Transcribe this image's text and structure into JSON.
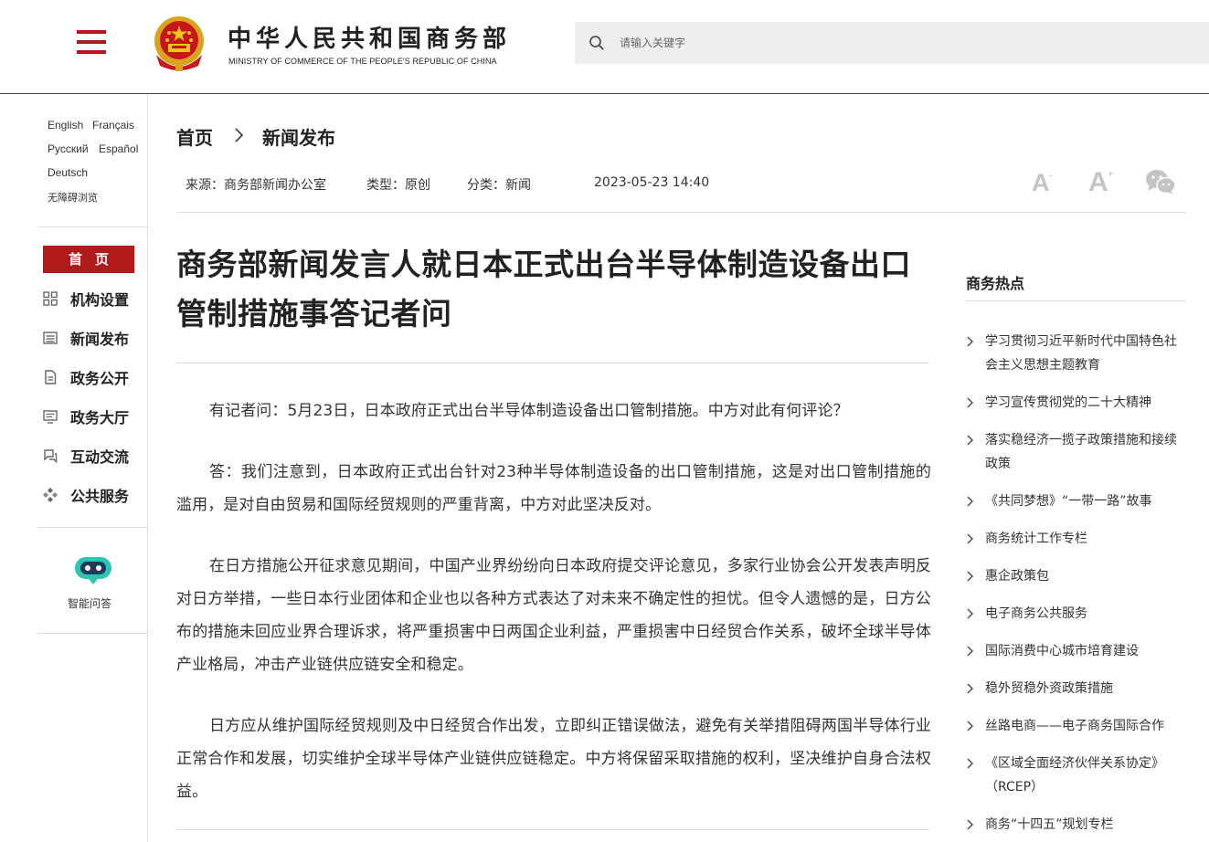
{
  "header": {
    "site_title_cn": "中华人民共和国商务部",
    "site_title_en": "MINISTRY OF COMMERCE OF THE PEOPLE'S REPUBLIC OF CHINA",
    "search_placeholder": "请输入关键字",
    "accent_color": "#b01a1a"
  },
  "languages": {
    "english": "English",
    "french": "Français",
    "russian": "Русский",
    "spanish": "Español",
    "german": "Deutsch",
    "accessible": "无障碍浏览"
  },
  "sidebar": {
    "home": "首页",
    "items": [
      {
        "label": "机构设置",
        "icon": "grid-icon"
      },
      {
        "label": "新闻发布",
        "icon": "news-icon"
      },
      {
        "label": "政务公开",
        "icon": "document-icon"
      },
      {
        "label": "政务大厅",
        "icon": "screen-icon"
      },
      {
        "label": "互动交流",
        "icon": "chat-icon"
      },
      {
        "label": "公共服务",
        "icon": "service-icon"
      }
    ],
    "assistant_label": "智能问答"
  },
  "breadcrumb": {
    "home": "首页",
    "current": "新闻发布"
  },
  "meta": {
    "source": "来源：商务部新闻办公室",
    "type": "类型：原创",
    "category": "分类：新闻",
    "datetime": "2023-05-23 14:40"
  },
  "article": {
    "title": "商务部新闻发言人就日本正式出台半导体制造设备出口管制措施事答记者问",
    "paragraphs": [
      "有记者问：5月23日，日本政府正式出台半导体制造设备出口管制措施。中方对此有何评论？",
      "答：我们注意到，日本政府正式出台针对23种半导体制造设备的出口管制措施，这是对出口管制措施的滥用，是对自由贸易和国际经贸规则的严重背离，中方对此坚决反对。",
      "在日方措施公开征求意见期间，中国产业界纷纷向日本政府提交评论意见，多家行业协会公开发表声明反对日方举措，一些日本行业团体和企业也以各种方式表达了对未来不确定性的担忧。但令人遗憾的是，日方公布的措施未回应业界合理诉求，将严重损害中日两国企业利益，严重损害中日经贸合作关系，破坏全球半导体产业格局，冲击产业链供应链安全和稳定。",
      "日方应从维护国际经贸规则及中日经贸合作出发，立即纠正错误做法，避免有关举措阻碍两国半导体行业正常合作和发展，切实维护全球半导体产业链供应链稳定。中方将保留采取措施的权利，坚决维护自身合法权益。"
    ]
  },
  "hot": {
    "title": "商务热点",
    "items": [
      "学习贯彻习近平新时代中国特色社会主义思想主题教育",
      "学习宣传贯彻党的二十大精神",
      "落实稳经济一揽子政策措施和接续政策",
      "《共同梦想》“一带一路”故事",
      "商务统计工作专栏",
      "惠企政策包",
      "电子商务公共服务",
      "国际消费中心城市培育建设",
      "稳外贸稳外资政策措施",
      "丝路电商——电子商务国际合作",
      "《区域全面经济伙伴关系协定》（RCEP）",
      "商务“十四五”规划专栏"
    ]
  }
}
